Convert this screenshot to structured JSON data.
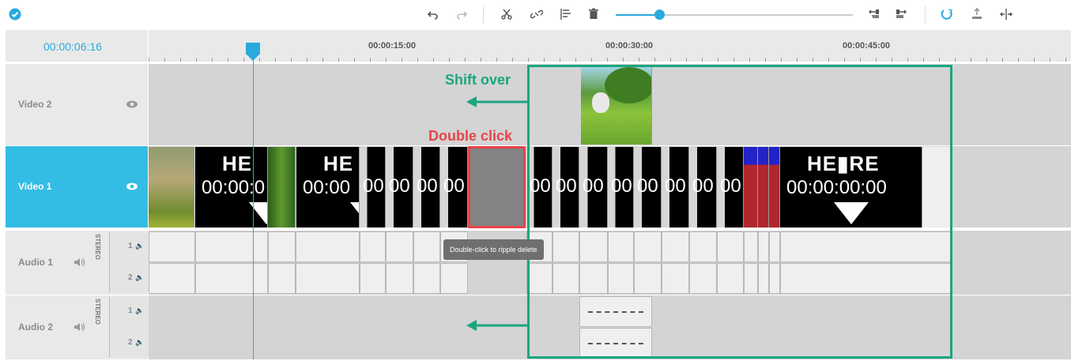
{
  "toolbar": {
    "icons": [
      "check-icon",
      "undo-icon",
      "redo-icon",
      "scissors-icon",
      "unlink-icon",
      "align-icon",
      "trash-icon",
      "zoom-slider",
      "move-left-icon",
      "move-right-icon",
      "magnet-icon",
      "lift-icon",
      "split-view-icon"
    ],
    "zoom_level": 0.07,
    "accent": "#2aa9dd"
  },
  "timecode": "00:00:06:16",
  "ruler": {
    "labels": [
      "00:00:15:00",
      "00:00:30:00",
      "00:00:45:00"
    ]
  },
  "tracks": [
    {
      "name": "Video 2"
    },
    {
      "name": "Video 1"
    },
    {
      "name": "Audio 1",
      "stereo": "STEREO",
      "ch1": "1",
      "ch2": "2"
    },
    {
      "name": "Audio 2",
      "stereo": "STEREO",
      "ch1": "1",
      "ch2": "2"
    }
  ],
  "clips": {
    "here_text": "HE",
    "here_big": "HE▮RE",
    "timecode_text": "00:00:0",
    "timecode_text_b": "00:00",
    "timecode_text_c": "00",
    "timecode_big": "00:00:00:00"
  },
  "annotations": {
    "shift_over": "Shift over",
    "double_click": "Double click",
    "tooltip": "Double-click to ripple delete"
  },
  "colors": {
    "active_track": "#33bce4",
    "annotation_red": "#e9434a",
    "annotation_green": "#1aa67f"
  }
}
